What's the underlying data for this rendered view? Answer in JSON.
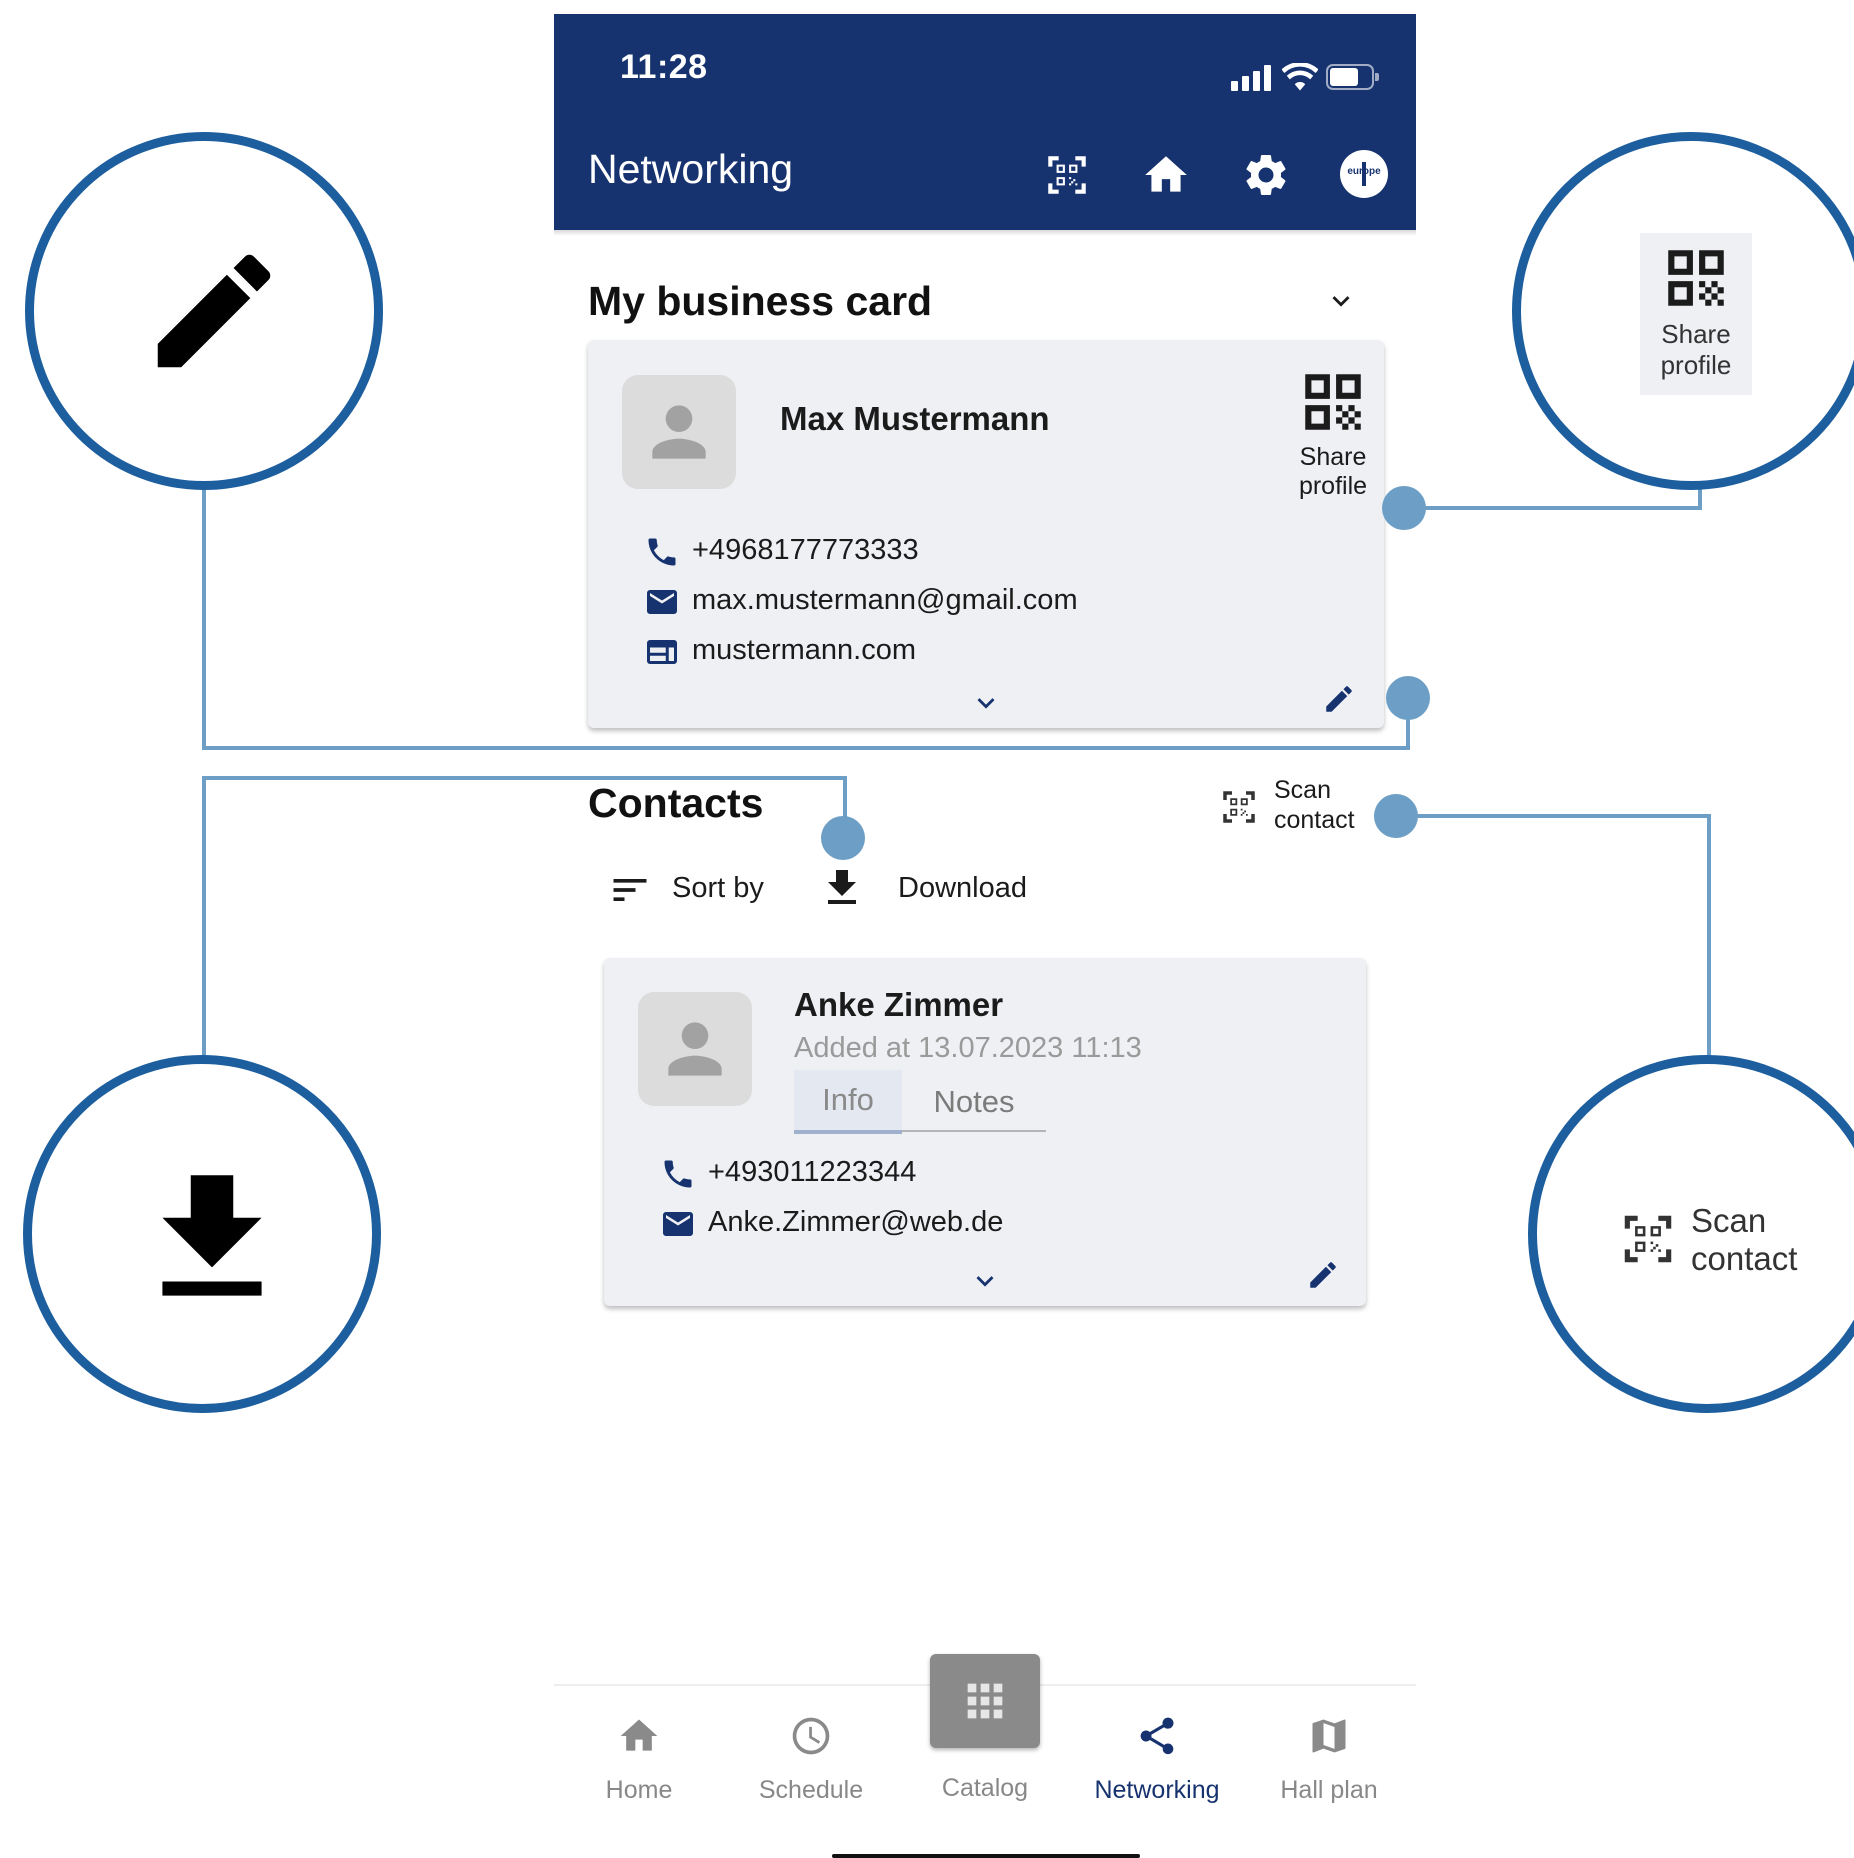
{
  "status_bar": {
    "time": "11:28"
  },
  "header": {
    "title": "Networking",
    "icons": [
      "qr-scan-icon",
      "home-icon",
      "gear-icon",
      "europe-info-icon"
    ],
    "logo_text": "europe"
  },
  "business_card": {
    "section_title": "My business card",
    "name": "Max Mustermann",
    "share_label_line1": "Share",
    "share_label_line2": "profile",
    "phone": "+4968177773333",
    "email": "max.mustermann@gmail.com",
    "website": "mustermann.com"
  },
  "contacts": {
    "section_title": "Contacts",
    "scan_label_line1": "Scan",
    "scan_label_line2": "contact",
    "sort_label": "Sort by",
    "download_label": "Download",
    "items": [
      {
        "name": "Anke Zimmer",
        "added": "Added at 13.07.2023 11:13",
        "tab_info": "Info",
        "tab_notes": "Notes",
        "phone": "+493011223344",
        "email": "Anke.Zimmer@web.de"
      }
    ]
  },
  "bottom_nav": {
    "items": [
      {
        "label": "Home",
        "icon": "home-icon"
      },
      {
        "label": "Schedule",
        "icon": "clock-icon"
      },
      {
        "label": "Catalog",
        "icon": "grid-icon"
      },
      {
        "label": "Networking",
        "icon": "share-icon",
        "active": true
      },
      {
        "label": "Hall plan",
        "icon": "map-icon"
      }
    ],
    "active_color": "#17336f"
  },
  "callouts": {
    "share_label_line1": "Share",
    "share_label_line2": "profile",
    "scan_label_line1": "Scan",
    "scan_label_line2": "contact",
    "icons": [
      "pencil-icon",
      "download-icon",
      "qr-share-icon",
      "qr-scan-icon"
    ]
  },
  "colors": {
    "header_bg": "#17336f",
    "callout_ring": "#1d5e9e",
    "connector": "#6d9fc6",
    "card_bg": "#eef0f4"
  }
}
